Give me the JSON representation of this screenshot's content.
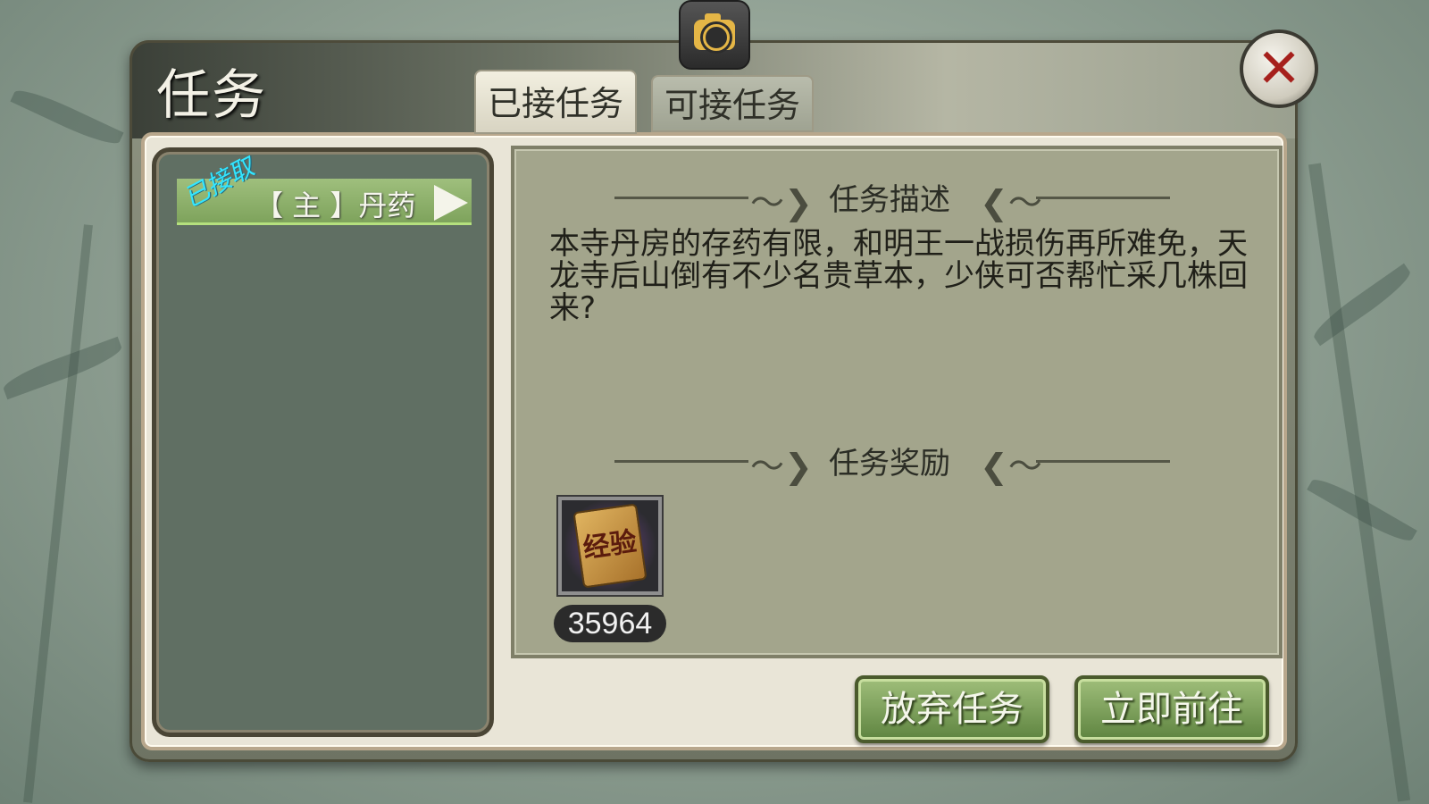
{
  "window": {
    "title": "任务"
  },
  "tabs": [
    {
      "label": "已接任务",
      "active": true
    },
    {
      "label": "可接任务",
      "active": false
    }
  ],
  "icons": {
    "camera": "camera-icon",
    "close": "close-icon",
    "arrow": "chevron-right-icon"
  },
  "quest_list": {
    "items": [
      {
        "stamp": "已接取",
        "label": "【 主 】丹药"
      }
    ]
  },
  "description": {
    "title": "任务描述",
    "text": "本寺丹房的存药有限，和明王一战损伤再所难免，天龙寺后山倒有不少名贵草本，少侠可否帮忙采几株回来?"
  },
  "rewards": {
    "title": "任务奖励",
    "items": [
      {
        "icon": "experience-icon",
        "icon_text": "经验",
        "count": "35964"
      }
    ]
  },
  "buttons": {
    "abandon": "放弃任务",
    "go_now": "立即前往"
  },
  "colors": {
    "accent_green": "#7ea35c",
    "close_red": "#a6201c",
    "stamp_cyan": "#33e6ff"
  }
}
